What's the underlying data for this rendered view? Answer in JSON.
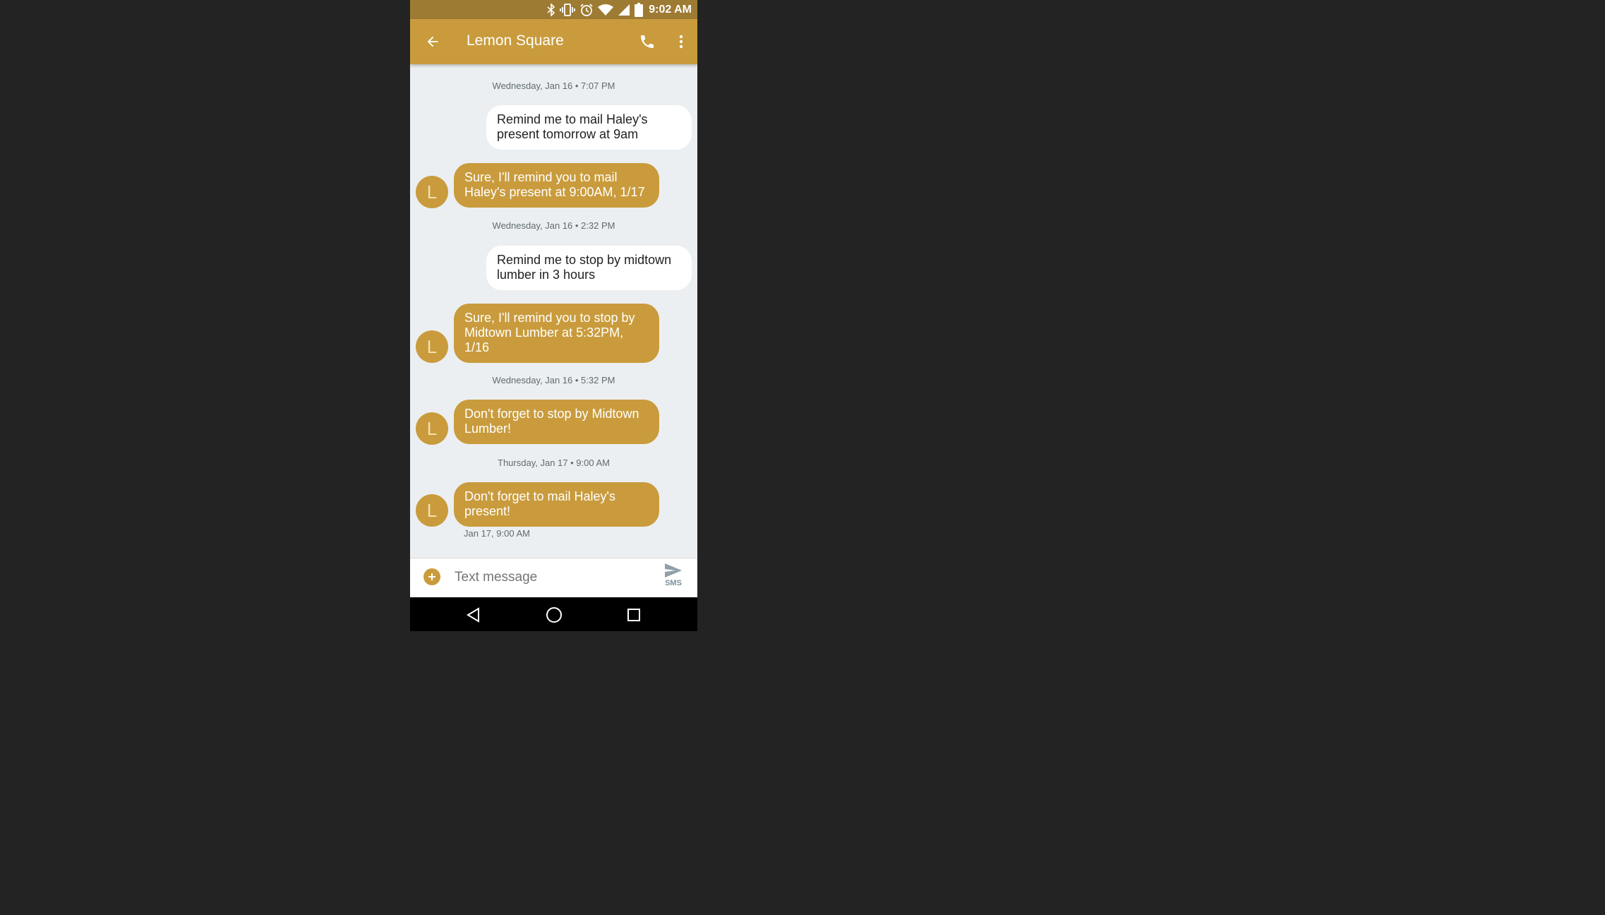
{
  "status_bar": {
    "time": "9:02 AM",
    "icons": [
      "bluetooth-icon",
      "vibrate-icon",
      "alarm-icon",
      "wifi-icon",
      "cell-signal-icon",
      "battery-icon"
    ]
  },
  "app_bar": {
    "title": "Lemon Square",
    "icons": [
      "back-arrow-icon",
      "phone-icon",
      "more-vert-icon"
    ]
  },
  "conversation": {
    "timestamps": [
      "Wednesday, Jan 16 • 7:07 PM",
      "Wednesday, Jan 16 • 2:32 PM",
      "Wednesday, Jan 16 • 5:32 PM",
      "Thursday, Jan 17 • 9:00 AM"
    ],
    "messages": [
      {
        "direction": "outgoing",
        "text": "Remind me to mail Haley's present tomorrow at 9am"
      },
      {
        "direction": "incoming",
        "avatar": "L",
        "text": "Sure, I'll remind you to mail Haley's present at 9:00AM, 1/17"
      },
      {
        "direction": "outgoing",
        "text": "Remind me to stop by midtown lumber in 3 hours"
      },
      {
        "direction": "incoming",
        "avatar": "L",
        "text": "Sure, I'll remind you to stop by Midtown Lumber at 5:32PM, 1/16"
      },
      {
        "direction": "incoming",
        "avatar": "L",
        "text": "Don't forget to stop by Midtown Lumber!"
      },
      {
        "direction": "incoming",
        "avatar": "L",
        "text": "Don't forget to mail Haley's present!"
      }
    ],
    "last_message_time": "Jan 17, 9:00 AM"
  },
  "compose": {
    "placeholder": "Text message",
    "send_label": "SMS",
    "icons": [
      "add-circle-icon",
      "send-icon"
    ]
  },
  "nav_bar": {
    "icons": [
      "back-triangle-icon",
      "home-circle-icon",
      "recents-square-icon"
    ]
  },
  "colors": {
    "accent": "#c99b3c",
    "status_bar": "#9e7b33",
    "conversation_bg": "#eceff1",
    "page_bg": "#232323"
  }
}
